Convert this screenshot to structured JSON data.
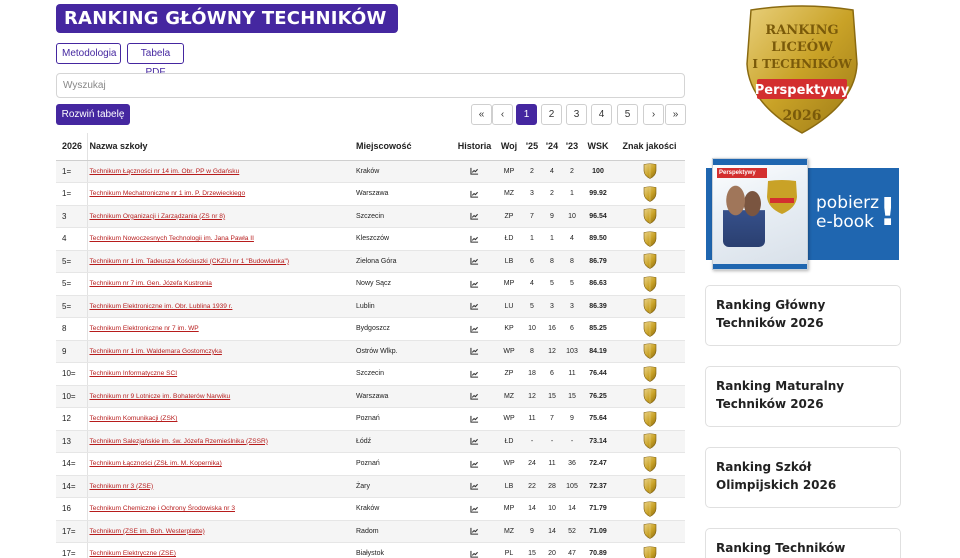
{
  "header": {
    "title": "RANKING GŁÓWNY TECHNIKÓW 2026"
  },
  "buttons": {
    "methodology": "Metodologia",
    "pdf": "Tabela PDF",
    "expand": "Rozwiń tabelę"
  },
  "search": {
    "placeholder": "Wyszukaj",
    "value": ""
  },
  "pagination": {
    "first": "«",
    "prev": "‹",
    "pages": [
      "1",
      "2",
      "3",
      "4",
      "5"
    ],
    "active": "1",
    "next": "›",
    "last": "»"
  },
  "table": {
    "headers": [
      "2026",
      "Nazwa szkoły",
      "Miejscowość",
      "Historia",
      "Woj",
      "'25",
      "'24",
      "'23",
      "WSK",
      "Znak jakości"
    ],
    "rows": [
      [
        "1=",
        "Technikum Łączności nr 14 im. Obr. PP w Gdańsku",
        "Kraków",
        "MP",
        "2",
        "4",
        "2",
        "100"
      ],
      [
        "1=",
        "Technikum Mechatroniczne nr 1 im. P. Drzewieckiego",
        "Warszawa",
        "MZ",
        "3",
        "2",
        "1",
        "99.92"
      ],
      [
        "3",
        "Technikum Organizacji i Zarządzania (ZS nr 8)",
        "Szczecin",
        "ZP",
        "7",
        "9",
        "10",
        "96.54"
      ],
      [
        "4",
        "Technikum Nowoczesnych Technologii im. Jana Pawła II",
        "Kleszczów",
        "ŁD",
        "1",
        "1",
        "4",
        "89.50"
      ],
      [
        "5=",
        "Technikum nr 1 im. Tadeusza Kościuszki (CKZiU nr 1 \"Budowlanka\")",
        "Zielona Góra",
        "LB",
        "6",
        "8",
        "8",
        "86.79"
      ],
      [
        "5=",
        "Technikum nr 7 im. Gen. Józefa Kustronia",
        "Nowy Sącz",
        "MP",
        "4",
        "5",
        "5",
        "86.63"
      ],
      [
        "5=",
        "Technikum Elektroniczne im. Obr. Lublina 1939 r.",
        "Lublin",
        "LU",
        "5",
        "3",
        "3",
        "86.39"
      ],
      [
        "8",
        "Technikum Elektroniczne nr 7 im. WP",
        "Bydgoszcz",
        "KP",
        "10",
        "16",
        "6",
        "85.25"
      ],
      [
        "9",
        "Technikum nr 1 im. Waldemara Gostomczyka",
        "Ostrów Wlkp.",
        "WP",
        "8",
        "12",
        "103",
        "84.19"
      ],
      [
        "10=",
        "Technikum Informatyczne SCI",
        "Szczecin",
        "ZP",
        "18",
        "6",
        "11",
        "76.44"
      ],
      [
        "10=",
        "Technikum nr 9 Lotnicze im. Bohaterów Narwiku",
        "Warszawa",
        "MZ",
        "12",
        "15",
        "15",
        "76.25"
      ],
      [
        "12",
        "Technikum Komunikacji (ZSK)",
        "Poznań",
        "WP",
        "11",
        "7",
        "9",
        "75.64"
      ],
      [
        "13",
        "Technikum Salezjańskie im. św. Józefa Rzemieślnika (ZSSR)",
        "Łódź",
        "ŁD",
        "-",
        "-",
        "-",
        "73.14"
      ],
      [
        "14=",
        "Technikum Łączności (ZSŁ im. M. Kopernika)",
        "Poznań",
        "WP",
        "24",
        "11",
        "36",
        "72.47"
      ],
      [
        "14=",
        "Technikum nr 3 (ZSE)",
        "Żary",
        "LB",
        "22",
        "28",
        "105",
        "72.37"
      ],
      [
        "16",
        "Technikum Chemiczne i Ochrony Środowiska nr 3",
        "Kraków",
        "MP",
        "14",
        "10",
        "14",
        "71.79"
      ],
      [
        "17=",
        "Technikum (ZSE im. Boh. Westerplatte)",
        "Radom",
        "MZ",
        "9",
        "14",
        "52",
        "71.09"
      ],
      [
        "17=",
        "Technikum Elektryczne (ZSE)",
        "Białystok",
        "PL",
        "15",
        "20",
        "47",
        "70.89"
      ]
    ]
  },
  "sidebar": {
    "badge": {
      "lines": [
        "RANKING",
        "LICEÓW",
        "I TECHNIKÓW"
      ],
      "brand": "Perspektywy",
      "year": "2026"
    },
    "ebook": {
      "cover_brand": "Perspektywy",
      "text_line1": "pobierz",
      "text_line2": "e-book",
      "excl": "!"
    },
    "cards": [
      "Ranking Główny Techników 2026",
      "Ranking Maturalny Techników 2026",
      "Ranking Szkół Olimpijskich 2026",
      "Ranking Techników"
    ]
  },
  "colors": {
    "primary": "#4527a0",
    "link": "#b71c1c",
    "ebook_blue": "#1f66b0",
    "gold": "#c9a227"
  }
}
